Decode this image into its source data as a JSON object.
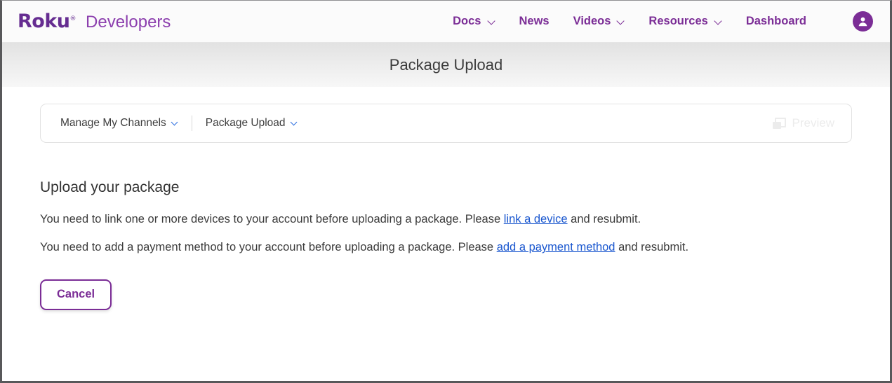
{
  "header": {
    "logo_text": "Roku",
    "logo_reg": "®",
    "product_name": "Developers",
    "nav": [
      {
        "label": "Docs",
        "has_chevron": true,
        "icon": "chevron-down-icon"
      },
      {
        "label": "News",
        "has_chevron": false,
        "icon": ""
      },
      {
        "label": "Videos",
        "has_chevron": true,
        "icon": "chevron-down-icon"
      },
      {
        "label": "Resources",
        "has_chevron": true,
        "icon": "chevron-down-icon"
      },
      {
        "label": "Dashboard",
        "has_chevron": false,
        "icon": ""
      }
    ],
    "account_icon": "user-account-icon"
  },
  "banner": {
    "title": "Package Upload"
  },
  "breadcrumb": {
    "items": [
      {
        "label": "Manage My Channels",
        "icon": "chevron-down-icon"
      },
      {
        "label": "Package Upload",
        "icon": "chevron-down-icon"
      }
    ],
    "preview": {
      "label": "Preview",
      "icon": "windows-copy-icon",
      "disabled": true
    }
  },
  "main": {
    "heading": "Upload your package",
    "messages": [
      {
        "before": "You need to link one or more devices to your account before uploading a package. Please ",
        "link": "link a device",
        "after": " and resubmit."
      },
      {
        "before": "You need to add a payment method to your account before uploading a package. Please ",
        "link": "add a payment method",
        "after": " and resubmit."
      }
    ],
    "cancel_label": "Cancel"
  },
  "colors": {
    "brand_purple": "#662d91",
    "nav_purple": "#7b2d96",
    "link_blue": "#1a57cf",
    "crumb_chevron_blue": "#2c6fe0",
    "text_dark": "#3a3a3a",
    "disabled_gray": "#ececec"
  }
}
